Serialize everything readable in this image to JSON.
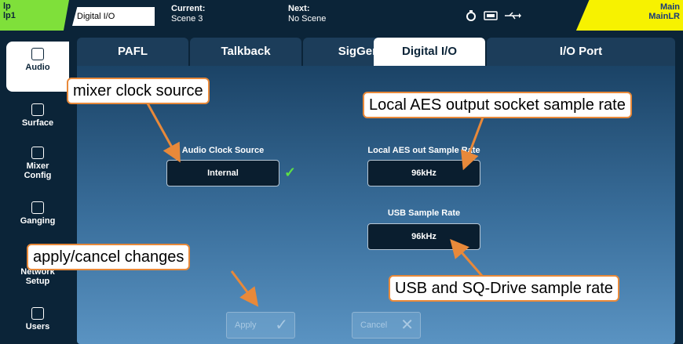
{
  "topbar": {
    "ip_line1": "lp",
    "ip_line2": "lp1",
    "screen_name": "Digital I/O",
    "current_label": "Current:",
    "current_value": "Scene 3",
    "next_label": "Next:",
    "next_value": "No Scene",
    "main_line1": "Main",
    "main_line2": "MainLR",
    "icons": [
      "network-icon",
      "card-icon",
      "usb-icon"
    ]
  },
  "sidenav": {
    "items": [
      {
        "label": "Audio",
        "icon": "speaker-icon"
      },
      {
        "label": "Surface",
        "icon": "surface-icon"
      },
      {
        "label": "Mixer Config",
        "icon": "mixer-config-icon"
      },
      {
        "label": "Ganging",
        "icon": "ganging-icon"
      },
      {
        "label": "Network Setup",
        "icon": "network-setup-icon"
      },
      {
        "label": "Users",
        "icon": "users-icon"
      }
    ]
  },
  "tabs": [
    "PAFL",
    "Talkback",
    "SigGen",
    "Digital I/O",
    "I/O Port"
  ],
  "panel": {
    "clock_label": "Audio Clock Source",
    "clock_value": "Internal",
    "aes_label": "Local AES out Sample Rate",
    "aes_value": "96kHz",
    "usb_label": "USB Sample Rate",
    "usb_value": "96kHz",
    "apply_label": "Apply",
    "cancel_label": "Cancel"
  },
  "callouts": {
    "clock": "mixer clock source",
    "aes": "Local AES output socket sample rate",
    "apply": "apply/cancel changes",
    "usb": "USB and SQ-Drive sample rate"
  },
  "colors": {
    "accent_green": "#7fe03a",
    "accent_yellow": "#f7f200",
    "callout_border": "#e8893a",
    "check_green": "#5de044"
  }
}
